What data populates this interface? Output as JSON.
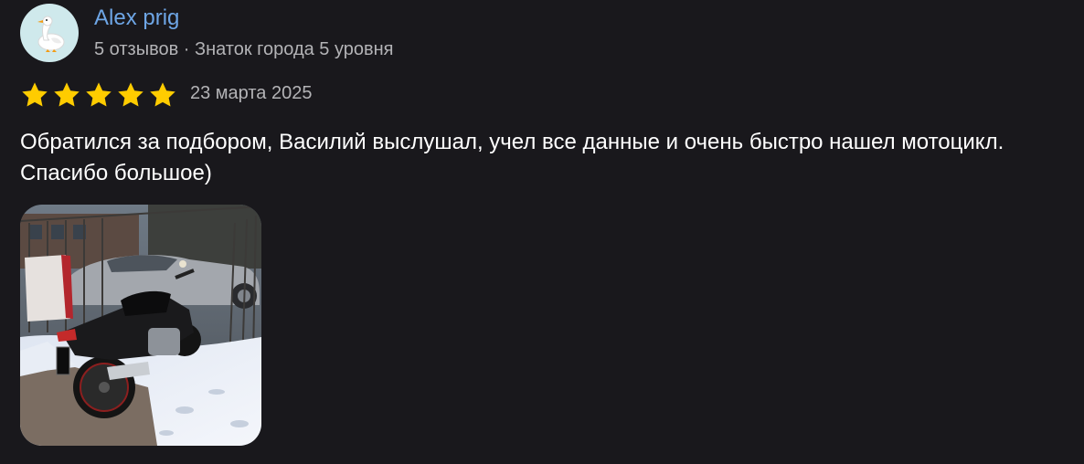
{
  "author": {
    "name": "Alex prig",
    "meta": "5 отзывов · Знаток города 5 уровня",
    "avatar_icon": "goose-emoji",
    "avatar_bg": "#cfe9ec"
  },
  "rating": {
    "stars": 5,
    "max": 5,
    "star_color": "#ffcc00",
    "date": "23 марта 2025"
  },
  "review_text": "Обратился за подбором, Василий выслушал, учел все данные и очень быстро нашел мотоцикл. Спасибо большое)",
  "photo": {
    "subject": "motorcycle-photo"
  },
  "colors": {
    "background": "#19181c",
    "name_link": "#6ea6e6",
    "secondary_text": "#b3b3b6",
    "text": "#ffffff"
  }
}
